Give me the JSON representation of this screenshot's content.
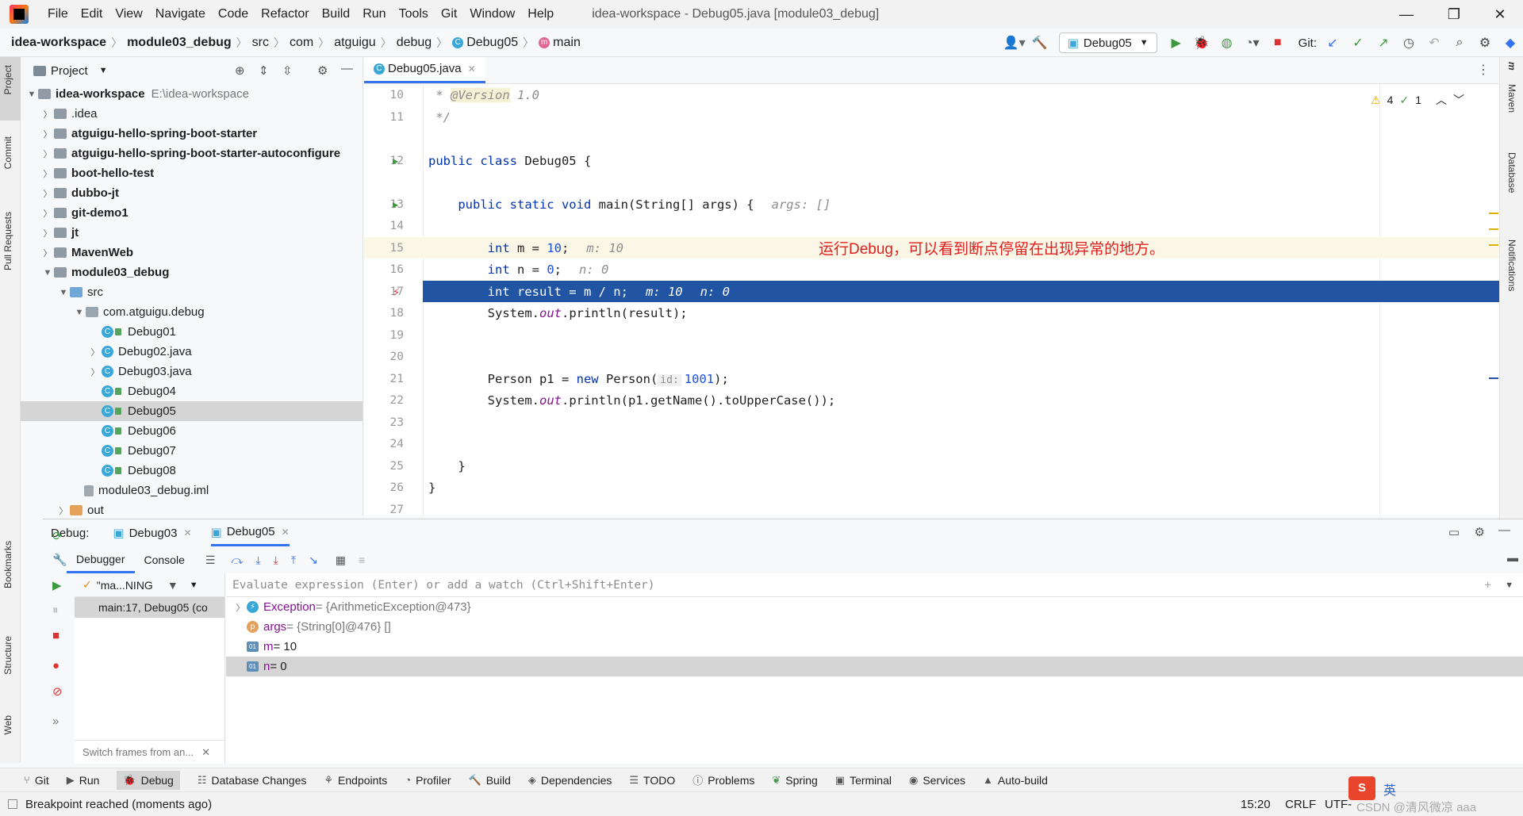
{
  "window": {
    "menu": [
      "File",
      "Edit",
      "View",
      "Navigate",
      "Code",
      "Refactor",
      "Build",
      "Run",
      "Tools",
      "Git",
      "Window",
      "Help"
    ],
    "title": "idea-workspace - Debug05.java [module03_debug]",
    "controls": {
      "minimize": "—",
      "restore": "❐",
      "close": "✕"
    }
  },
  "breadcrumb": {
    "project": "idea-workspace",
    "module": "module03_debug",
    "src": "src",
    "pkg1": "com",
    "pkg2": "atguigu",
    "pkg3": "debug",
    "file": "Debug05",
    "method": "main"
  },
  "toolbar": {
    "run_config": "Debug05",
    "git_label": "Git:"
  },
  "left_strip": {
    "project": "Project",
    "commit": "Commit",
    "pull_requests": "Pull Requests",
    "bookmarks": "Bookmarks",
    "structure": "Structure",
    "web": "Web"
  },
  "right_strip": {
    "maven": "Maven",
    "database": "Database",
    "notifications": "Notifications"
  },
  "project_panel": {
    "title": "Project",
    "root": {
      "name": "idea-workspace",
      "path": "E:\\idea-workspace"
    },
    "items": [
      {
        "label": ".idea",
        "bold": false
      },
      {
        "label": "atguigu-hello-spring-boot-starter",
        "bold": true
      },
      {
        "label": "atguigu-hello-spring-boot-starter-autoconfigure",
        "bold": true
      },
      {
        "label": "boot-hello-test",
        "bold": true
      },
      {
        "label": "dubbo-jt",
        "bold": true
      },
      {
        "label": "git-demo1",
        "bold": true
      },
      {
        "label": "jt",
        "bold": true
      },
      {
        "label": "MavenWeb",
        "bold": true
      },
      {
        "label": "module03_debug",
        "bold": true
      }
    ],
    "src": "src",
    "package": "com.atguigu.debug",
    "classes": [
      "Debug01",
      "Debug02.java",
      "Debug03.java",
      "Debug04",
      "Debug05",
      "Debug06",
      "Debug07",
      "Debug08"
    ],
    "iml": "module03_debug.iml",
    "out": "out"
  },
  "editor": {
    "tab": "Debug05.java",
    "warnings": "4",
    "checks": "1",
    "lines": [
      {
        "n": "10"
      },
      {
        "n": "11"
      },
      {
        "n": "12"
      },
      {
        "n": "13"
      },
      {
        "n": "14"
      },
      {
        "n": "15"
      },
      {
        "n": "16"
      },
      {
        "n": "17"
      },
      {
        "n": "18"
      },
      {
        "n": "19"
      },
      {
        "n": "20"
      },
      {
        "n": "21"
      },
      {
        "n": "22"
      },
      {
        "n": "23"
      },
      {
        "n": "24"
      },
      {
        "n": "25"
      },
      {
        "n": "26"
      },
      {
        "n": "27"
      }
    ],
    "code": {
      "l10_star": " * ",
      "l10_tag": "@Version",
      "l10_val": " 1.0",
      "l11": " */",
      "l12_kw": "public class",
      "l12_rest": " Debug05 {",
      "l13_kw": "    public static void",
      "l13_rest": " main(String[] args) {",
      "l13_hint": "args: []",
      "l15_kw": "        int",
      "l15_mid": " m = ",
      "l15_num": "10",
      "l15_end": ";",
      "l15_hint": "m: 10",
      "l16_kw": "        int",
      "l16_mid": " n = ",
      "l16_num": "0",
      "l16_end": ";",
      "l16_hint": "n: 0",
      "l17_kw": "        int",
      "l17_rest": " result = m / n;",
      "l17_hint1": "m: 10",
      "l17_hint2": "n: 0",
      "l18_a": "        System.",
      "l18_b": "out",
      "l18_c": ".println(result);",
      "l21_a": "        Person p1 = ",
      "l21_kw": "new",
      "l21_b": " Person(",
      "l21_hint": "id:",
      "l21_num": "1001",
      "l21_c": ");",
      "l22_a": "        System.",
      "l22_b": "out",
      "l22_c": ".println(p1.getName().toUpperCase());",
      "l25": "    }",
      "l26": "}"
    },
    "annotation": "运行Debug，可以看到断点停留在出现异常的地方。"
  },
  "debug": {
    "label": "Debug:",
    "sessions": [
      "Debug03",
      "Debug05"
    ],
    "tabs": [
      "Debugger",
      "Console"
    ],
    "thread": "\"ma...NING",
    "frame": "main:17, Debug05 (co",
    "switch_frames": "Switch frames from an...",
    "eval_placeholder": "Evaluate expression (Enter) or add a watch (Ctrl+Shift+Enter)",
    "variables": [
      {
        "name": "Exception",
        "value": " = {ArithmeticException@473}"
      },
      {
        "name": "args",
        "value": " = {String[0]@476} []"
      },
      {
        "name": "m",
        "value": " = 10"
      },
      {
        "name": "n",
        "value": " = 0"
      }
    ]
  },
  "tool_windows": [
    "Git",
    "Run",
    "Debug",
    "Database Changes",
    "Endpoints",
    "Profiler",
    "Build",
    "Dependencies",
    "TODO",
    "Problems",
    "Spring",
    "Terminal",
    "Services",
    "Auto-build"
  ],
  "status": {
    "message": "Breakpoint reached (moments ago)",
    "position": "15:20",
    "line_sep": "CRLF",
    "encoding": "UTF-",
    "watermark": "CSDN @清风微凉 aaa",
    "ime": "英"
  },
  "colors": {
    "selection": "#2154a3",
    "accent": "#3574f0",
    "annotation": "#e02020"
  }
}
